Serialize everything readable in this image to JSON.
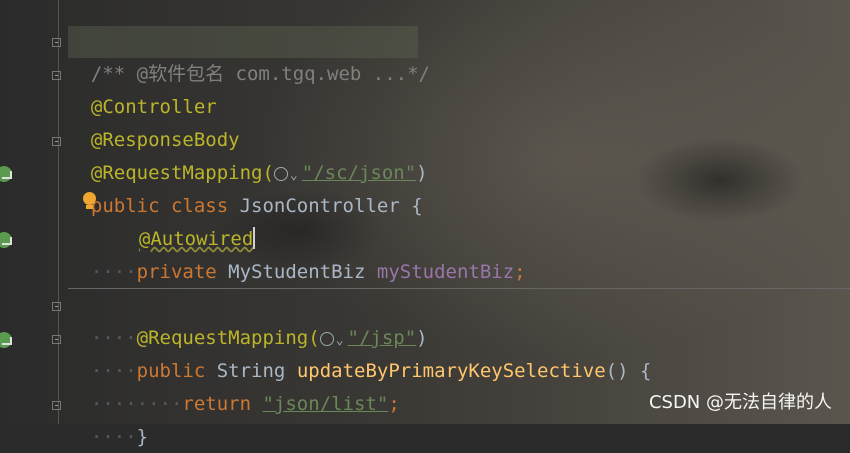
{
  "code": {
    "l1_comment": "/** @软件包名 com.tgq.web ...*/",
    "l2_anno": "@Controller",
    "l3_anno": "@ResponseBody",
    "l4_anno": "@RequestMapping(",
    "l4_str": "\"/sc/json\"",
    "l4_close": ")",
    "l5_kw": "public class ",
    "l5_name": "JsonController {",
    "l6_anno": "@Autowired",
    "l7_dots": "····",
    "l7_kw": "private ",
    "l7_type": "MyStudentBiz ",
    "l7_field": "myStudentBiz",
    "l7_semi": ";",
    "l9_dots": "····",
    "l9_anno": "@RequestMapping(",
    "l9_str": "\"/jsp\"",
    "l9_close": ")",
    "l10_dots": "····",
    "l10_kw": "public ",
    "l10_type": "String ",
    "l10_method": "updateByPrimaryKeySelective",
    "l10_rest": "() {",
    "l11_dots": "········",
    "l11_kw": "return ",
    "l11_str": "\"json/list\"",
    "l11_semi": ";",
    "l12_dots": "····",
    "l12_brace": "}"
  },
  "watermark": "CSDN @无法自律的人",
  "colors": {
    "annotation": "#bbb529",
    "keyword": "#cc7832",
    "string": "#6a8759",
    "field": "#9876aa",
    "method": "#ffc66d",
    "comment": "#808080"
  },
  "icons": [
    "run-gutter-icon",
    "fold-icon",
    "bulb-icon",
    "globe-icon"
  ]
}
